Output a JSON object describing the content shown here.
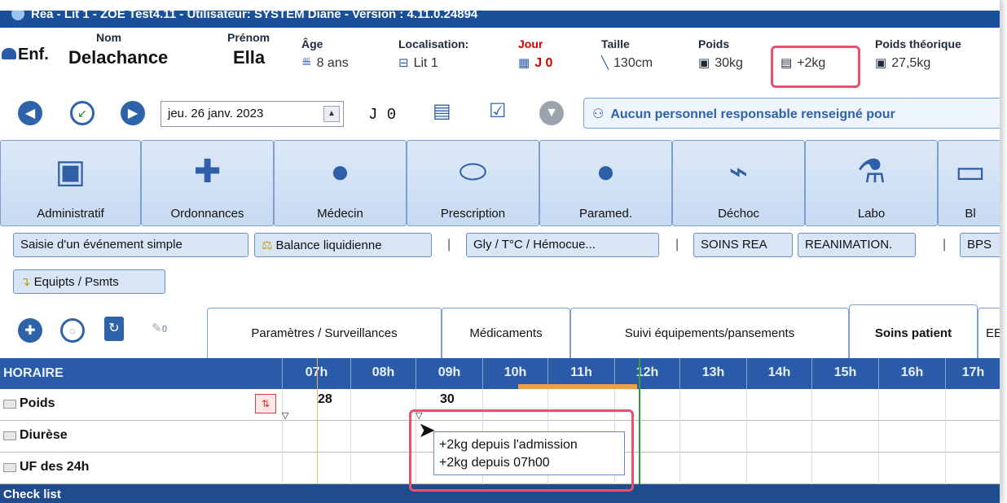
{
  "window": {
    "title": "Rea - Lit 1 - ZOE Test4.11 - Utilisateur: SYSTEM Diane - Version : 4.11.0.24894"
  },
  "patient": {
    "type": "Enf.",
    "nom_label": "Nom",
    "nom": "Delachance",
    "prenom_label": "Prénom",
    "prenom": "Ella",
    "age_label": "Âge",
    "age": "8 ans",
    "localisation_label": "Localisation:",
    "localisation": "Lit 1",
    "jour_label": "Jour",
    "jour": "J 0",
    "taille_label": "Taille",
    "taille": "130cm",
    "poids_label": "Poids",
    "poids": "30kg",
    "delta_poids": "+2kg",
    "poids_theo_label": "Poids théorique",
    "poids_theo": "27,5kg"
  },
  "nav": {
    "date": "jeu. 26 janv. 2023",
    "dropdown_glyph": "▲",
    "jday": "J 0",
    "responsable": "Aucun personnel responsable renseigné pour"
  },
  "modules": [
    {
      "label": "Administratif",
      "icon": "clipboard-icon"
    },
    {
      "label": "Ordonnances",
      "icon": "medical-cross-icon"
    },
    {
      "label": "Médecin",
      "icon": "doctor-icon"
    },
    {
      "label": "Prescription",
      "icon": "pill-icon"
    },
    {
      "label": "Paramed.",
      "icon": "nurse-icon"
    },
    {
      "label": "Déchoc",
      "icon": "chart-line-icon"
    },
    {
      "label": "Labo",
      "icon": "microscope-icon"
    },
    {
      "label": "Bl",
      "icon": "monitor-icon"
    }
  ],
  "quick": {
    "saisie": "Saisie d'un événement simple",
    "balance": "Balance liquidienne",
    "gly": "Gly / T°C / Hémocue...",
    "soins_rea": "SOINS REA",
    "reanimation": "REANIMATION.",
    "bps": "BPS",
    "equipts": "Equipts / Psmts",
    "sep": "|"
  },
  "tabs": {
    "pin_count": "0",
    "items": [
      "Paramètres / Surveillances",
      "Médicaments",
      "Suivi équipements/pansements",
      "Soins patient",
      "EE"
    ]
  },
  "grid": {
    "header_title": "HORAIRE",
    "hours": [
      "07h",
      "08h",
      "09h",
      "10h",
      "11h",
      "12h",
      "13h",
      "14h",
      "15h",
      "16h",
      "17h"
    ],
    "rows": [
      "Poids",
      "Diurèse",
      "UF des 24h"
    ],
    "poids_values": [
      "28",
      "30"
    ],
    "checklist": "Check list"
  },
  "tooltip": {
    "line1": "+2kg depuis l'admission",
    "line2": "+2kg depuis 07h00"
  },
  "colors": {
    "accent": "#2a5ba8",
    "highlight": "#e8506e",
    "red": "#d40000",
    "titlebar": "#1a4f9a"
  }
}
